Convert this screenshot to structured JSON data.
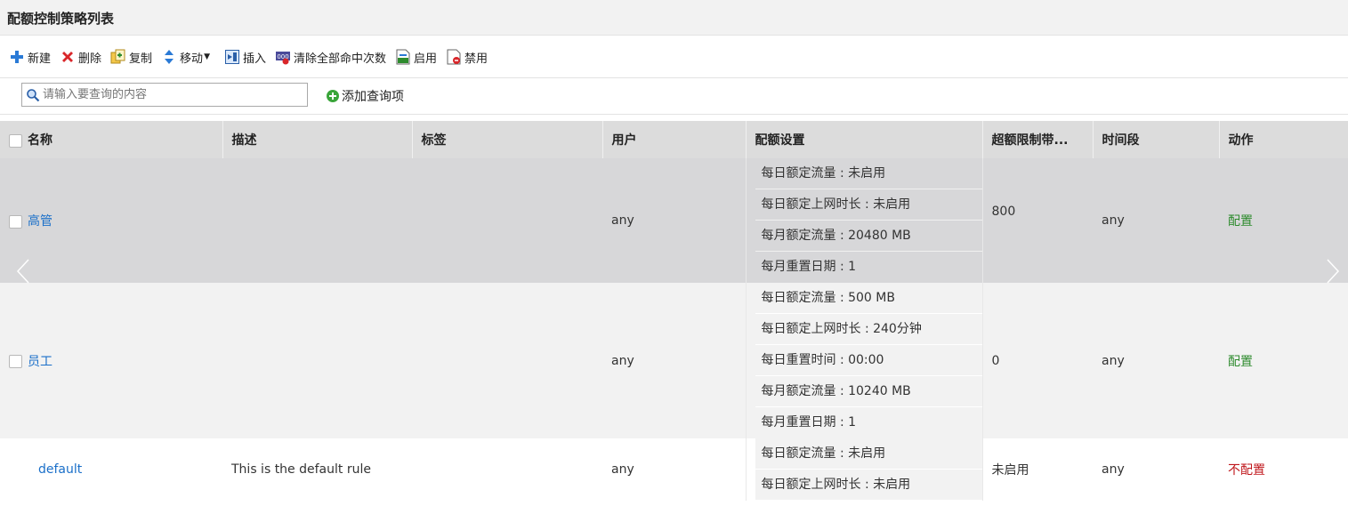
{
  "page": {
    "title": "配额控制策略列表"
  },
  "toolbar": {
    "new_label": "新建",
    "delete_label": "删除",
    "copy_label": "复制",
    "move_label": "移动",
    "insert_label": "插入",
    "clear_hits_label": "清除全部命中次数",
    "enable_label": "启用",
    "disable_label": "禁用"
  },
  "search": {
    "placeholder": "请输入要查询的内容",
    "add_query_label": "添加查询项"
  },
  "table": {
    "columns": {
      "name": "名称",
      "description": "描述",
      "tag": "标签",
      "user": "用户",
      "quota": "配额设置",
      "over_limit": "超额限制带...",
      "time": "时间段",
      "action": "动作"
    },
    "rows": [
      {
        "name": "高管",
        "description": "",
        "tag": "",
        "user": "any",
        "quota": [
          "每日额定流量 : 未启用",
          "每日额定上网时长 : 未启用",
          "每月额定流量 : 20480 MB",
          "每月重置日期 : 1"
        ],
        "over_limit": "800",
        "time": "any",
        "action": "配置"
      },
      {
        "name": "员工",
        "description": "",
        "tag": "",
        "user": "any",
        "quota": [
          "每日额定流量 : 500 MB",
          "每日额定上网时长 : 240分钟",
          "每日重置时间 : 00:00",
          "每月额定流量 : 10240 MB",
          "每月重置日期 : 1"
        ],
        "over_limit": "0",
        "time": "any",
        "action": "配置"
      },
      {
        "name": "default",
        "description": "This is the default rule",
        "tag": "",
        "user": "any",
        "quota": [
          "每日额定流量 : 未启用",
          "每日额定上网时长 : 未启用"
        ],
        "over_limit": "未启用",
        "time": "any",
        "action": "不配置"
      }
    ]
  },
  "colors": {
    "link": "#1a6fc9",
    "action_configured": "#2e8b2e",
    "action_not_configured": "#c0171c",
    "header_bg": "#dcdcdc",
    "selected_row_bg": "#d7d7d9"
  },
  "icons": {
    "new": "plus-icon",
    "delete": "x-icon",
    "copy": "copy-icon",
    "move": "up-down-arrow-icon",
    "insert": "insert-icon",
    "clear_hits": "clear-counter-icon",
    "enable": "enable-icon",
    "disable": "disable-icon",
    "search": "magnifier-icon",
    "add_query": "green-plus-circle-icon",
    "prev": "chevron-left-icon",
    "next": "chevron-right-icon"
  }
}
